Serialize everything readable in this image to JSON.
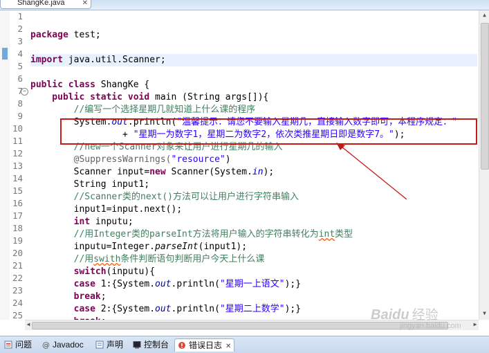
{
  "editor": {
    "tab_title": "ShangKe.java",
    "line_numbers": [
      "1",
      "2",
      "3",
      "4",
      "5",
      "6",
      "7",
      "8",
      "9",
      "10",
      "11",
      "12",
      "13",
      "14",
      "15",
      "16",
      "17",
      "18",
      "19",
      "20",
      "21",
      "22",
      "23",
      "24",
      "25"
    ],
    "lines": {
      "l2": {
        "a": "package",
        "b": " test;"
      },
      "l4": {
        "a": "import",
        "b": " java.util.Scanner;"
      },
      "l6": {
        "a": "public class",
        "b": " ShangKe {"
      },
      "l7": {
        "a": "    public static void",
        "b": " main (String args[]){"
      },
      "l8": {
        "a": "        //编写一个选择星期几就知道上什么课的程序"
      },
      "l9": {
        "a": "        System.",
        "b": "out",
        "c": ".println(",
        "d": "\"温馨提示：请您不要输入星期几，直接输入数字即可，本程序规定：\""
      },
      "l10": {
        "a": "                 + ",
        "b": "\"星期一为数字1，星期二为数字2，依次类推星期日即是数字7。\"",
        "c": ");"
      },
      "l11": {
        "a": "        //new一个Scanner对象来让用户进行星期几的输入"
      },
      "l12": {
        "a": "        @SuppressWarnings(",
        "b": "\"resource\"",
        "c": ")"
      },
      "l13": {
        "a": "        Scanner input=",
        "b": "new",
        "c": " Scanner(System.",
        "d": "in",
        "e": ");"
      },
      "l14": {
        "a": "        String input1;"
      },
      "l15": {
        "a": "        //Scanner类的next()方法可以让用户进行字符串输入"
      },
      "l16": {
        "a": "        input1=input.next();"
      },
      "l17": {
        "a": "        int",
        "b": " inputu;"
      },
      "l18": {
        "a": "        //用Integer类的parseInt方法将用户输入的字符串转化为",
        "b": "int",
        "c": "类型"
      },
      "l19": {
        "a": "        inputu=Integer.",
        "b": "parseInt",
        "c": "(input1);"
      },
      "l20": {
        "a": "        //用",
        "b": "swith",
        "c": "条件判断语句判断用户今天上什么课"
      },
      "l21": {
        "a": "        switch",
        "b": "(inputu){"
      },
      "l22": {
        "a": "        case",
        "b": " 1:{System.",
        "c": "out",
        "d": ".println(",
        "e": "\"星期一上语文\"",
        "f": ");}"
      },
      "l23": {
        "a": "        break",
        "b": ";"
      },
      "l24": {
        "a": "        case",
        "b": " 2:{System.",
        "c": "out",
        "d": ".println(",
        "e": "\"星期二上数学\"",
        "f": ");}"
      },
      "l25": {
        "a": "        break",
        "b": ";"
      }
    }
  },
  "views": {
    "tabs": [
      "问题",
      "Javadoc",
      "声明",
      "控制台",
      "错误日志"
    ],
    "active": "错误日志"
  },
  "watermark": {
    "brand": "Baidu",
    "text": "经验",
    "url": "jingyan.baidu.com"
  },
  "colors": {
    "keyword": "#7f0055",
    "comment": "#3f7f5f",
    "string": "#2a00ff",
    "highlight_box": "#c41a1a"
  }
}
